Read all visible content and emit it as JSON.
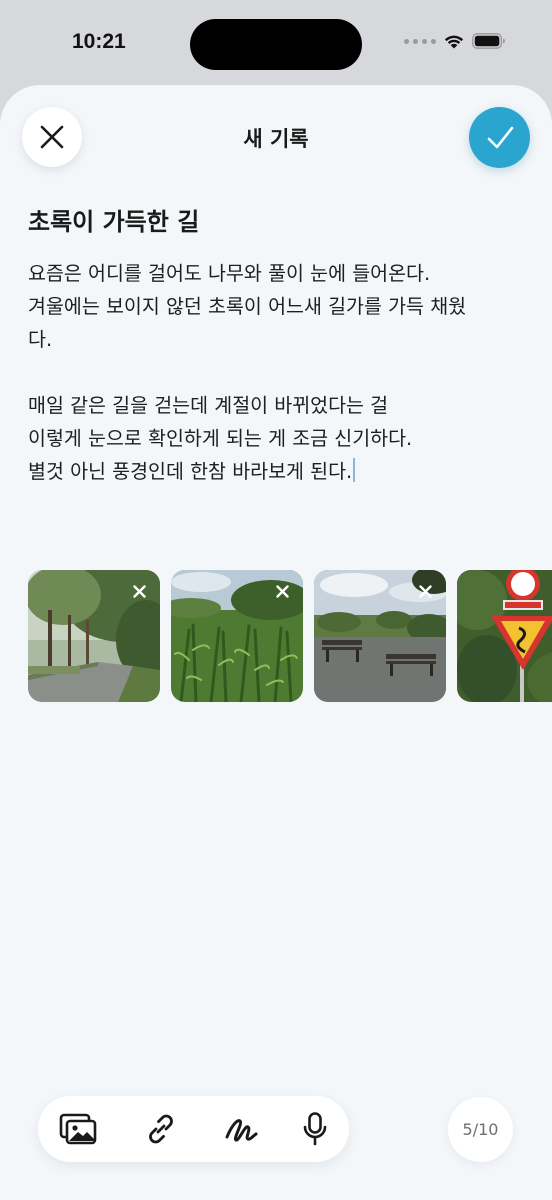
{
  "status_bar": {
    "time": "10:21",
    "signal_icon": "cellular-signal-icon",
    "wifi_icon": "wifi-icon",
    "battery_icon": "battery-icon"
  },
  "header": {
    "title": "새 기록",
    "close_icon": "close-icon",
    "confirm_icon": "checkmark-icon",
    "confirm_color": "#2aa5cf"
  },
  "entry": {
    "title": "초록이 가득한 길",
    "paragraphs": [
      [
        "요즘은 어디를 걸어도 나무와 풀이 눈에 들어온다.",
        "겨울에는 보이지 않던 초록이 어느새 길가를 가득 채웠",
        "다."
      ],
      [
        "매일 같은 길을 걷는데 계절이 바뀌었다는 걸",
        "이렇게 눈으로 확인하게 되는 게 조금 신기하다.",
        "별것 아닌 풍경인데 한참 바라보게 된다."
      ]
    ]
  },
  "photos": [
    {
      "subject": "tree-lined path"
    },
    {
      "subject": "tall grass field"
    },
    {
      "subject": "park benches"
    },
    {
      "subject": "road signs"
    }
  ],
  "toolbar": {
    "items": [
      {
        "icon": "photo-gallery-icon"
      },
      {
        "icon": "link-icon"
      },
      {
        "icon": "drawing-icon"
      },
      {
        "icon": "microphone-icon"
      }
    ]
  },
  "photo_counter": "5/10",
  "colors": {
    "sheet_background": "#f4f7fa",
    "accent": "#2aa5cf",
    "text": "#1a1a1a"
  }
}
